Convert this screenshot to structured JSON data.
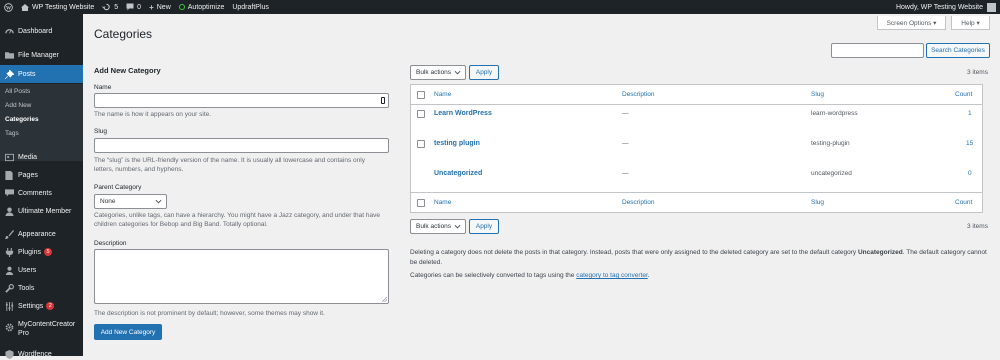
{
  "adminbar": {
    "site_name": "WP Testing Website",
    "updates": "5",
    "comments": "0",
    "new": "New",
    "autoptimize": "Autoptimize",
    "updraft": "UpdraftPlus",
    "howdy": "Howdy, WP Testing Website"
  },
  "sidebar": {
    "items": [
      {
        "label": "Dashboard",
        "icon": "gauge-icon"
      },
      {
        "label": "File Manager",
        "icon": "folder-icon"
      },
      {
        "label": "Posts",
        "icon": "pin-icon"
      },
      {
        "label": "Media",
        "icon": "media-icon"
      },
      {
        "label": "Pages",
        "icon": "page-icon"
      },
      {
        "label": "Comments",
        "icon": "comment-icon"
      },
      {
        "label": "Ultimate Member",
        "icon": "user-icon"
      },
      {
        "label": "Appearance",
        "icon": "brush-icon"
      },
      {
        "label": "Plugins",
        "icon": "plug-icon",
        "badge": "5"
      },
      {
        "label": "Users",
        "icon": "users-icon"
      },
      {
        "label": "Tools",
        "icon": "wrench-icon"
      },
      {
        "label": "Settings",
        "icon": "sliders-icon",
        "badge": "2"
      },
      {
        "label": "MyContentCreator",
        "label2": "Pro",
        "icon": "gear-icon"
      },
      {
        "label": "Wordfence",
        "icon": "shield-icon"
      }
    ],
    "submenu": [
      "All Posts",
      "Add New",
      "Categories",
      "Tags"
    ]
  },
  "page": {
    "title": "Categories",
    "screen_options": "Screen Options ▾",
    "help": "Help ▾",
    "search_button": "Search Categories"
  },
  "form": {
    "heading": "Add New Category",
    "name_label": "Name",
    "name_help": "The name is how it appears on your site.",
    "slug_label": "Slug",
    "slug_help": "The “slug” is the URL-friendly version of the name. It is usually all lowercase and contains only letters, numbers, and hyphens.",
    "parent_label": "Parent Category",
    "parent_value": "None",
    "parent_help": "Categories, unlike tags, can have a hierarchy. You might have a Jazz category, and under that have children categories for Bebop and Big Band. Totally optional.",
    "desc_label": "Description",
    "desc_help": "The description is not prominent by default; however, some themes may show it.",
    "submit": "Add New Category"
  },
  "table": {
    "bulk": "Bulk actions",
    "apply": "Apply",
    "items_count": "3 items",
    "columns": {
      "name": "Name",
      "description": "Description",
      "slug": "Slug",
      "count": "Count"
    },
    "rows": [
      {
        "name": "Learn WordPress",
        "description": "—",
        "slug": "learn-wordpress",
        "count": "1"
      },
      {
        "name": "testing plugin",
        "description": "—",
        "slug": "testing-plugin",
        "count": "15"
      },
      {
        "name": "Uncategorized",
        "description": "—",
        "slug": "uncategorized",
        "count": "0"
      }
    ]
  },
  "notes": {
    "delete_a": "Deleting a category does not delete the posts in that category. Instead, posts that were only assigned to the deleted category are set to the default category ",
    "delete_b": "Uncategorized",
    "delete_c": ". The default category cannot be deleted.",
    "convert_a": "Categories can be selectively converted to tags using the ",
    "convert_link": "category to tag converter",
    "convert_c": "."
  },
  "colors": {
    "accent": "#2271b1",
    "sidebar": "#1d2327",
    "badge": "#d63638"
  }
}
